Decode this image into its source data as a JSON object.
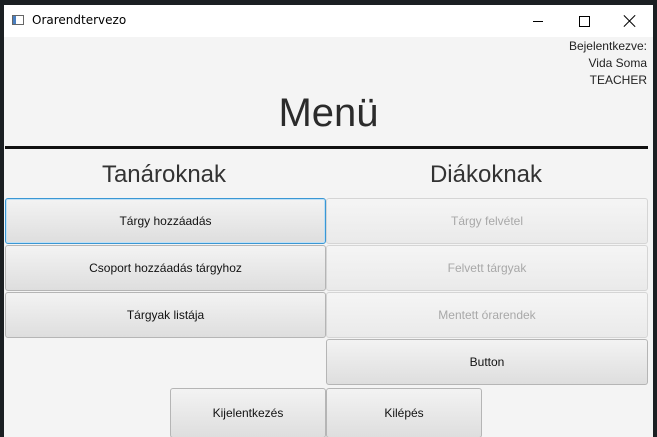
{
  "window": {
    "title": "Orarendtervezo"
  },
  "login_info": {
    "label": "Bejelentkezve:",
    "name": "Vida Soma",
    "role": "TEACHER"
  },
  "menu": {
    "title": "Menü"
  },
  "teachers": {
    "heading": "Tanároknak",
    "buttons": [
      "Tárgy hozzáadás",
      "Csoport hozzáadás tárgyhoz",
      "Tárgyak listája"
    ]
  },
  "students": {
    "heading": "Diákoknak",
    "buttons": [
      "Tárgy felvétel",
      "Felvett tárgyak",
      "Mentett órarendek",
      "Button"
    ]
  },
  "footer": {
    "logout_label": "Kijelentkezés",
    "exit_label": "Kilépés"
  }
}
